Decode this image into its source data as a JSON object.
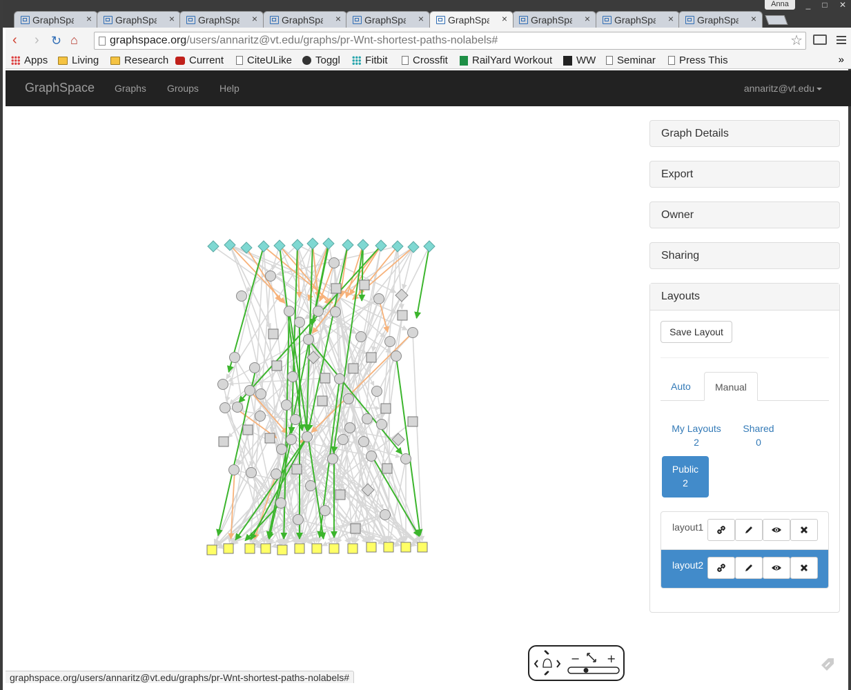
{
  "browser": {
    "tabs": [
      {
        "label": "GraphSpa",
        "active": false
      },
      {
        "label": "GraphSpa",
        "active": false
      },
      {
        "label": "GraphSpa",
        "active": false
      },
      {
        "label": "GraphSpa",
        "active": false
      },
      {
        "label": "GraphSpa",
        "active": false
      },
      {
        "label": "GraphSpa",
        "active": true
      },
      {
        "label": "GraphSpa",
        "active": false
      },
      {
        "label": "GraphSpa",
        "active": false
      },
      {
        "label": "GraphSpa",
        "active": false
      }
    ],
    "profile_name": "Anna",
    "url_host": "graphspace.org",
    "url_path": "/users/annaritz@vt.edu/graphs/pr-Wnt-shortest-paths-nolabels#",
    "bookmarks": [
      "Apps",
      "Living",
      "Research",
      "Current",
      "CiteULike",
      "Toggl",
      "Fitbit",
      "Crossfit",
      "RailYard Workout",
      "WW",
      "Seminar",
      "Press This"
    ],
    "bookmarks_more": "»",
    "status_text": "graphspace.org/users/annaritz@vt.edu/graphs/pr-Wnt-shortest-paths-nolabels#"
  },
  "navbar": {
    "brand": "GraphSpace",
    "links": [
      "Graphs",
      "Groups",
      "Help"
    ],
    "user": "annaritz@vt.edu"
  },
  "sidebar": {
    "panels": [
      "Graph Details",
      "Export",
      "Owner",
      "Sharing"
    ],
    "layouts": {
      "title": "Layouts",
      "save_label": "Save Layout",
      "tabs": [
        "Auto",
        "Manual"
      ],
      "active_tab": "Manual",
      "filters": [
        {
          "label": "My Layouts",
          "count": "2"
        },
        {
          "label": "Shared",
          "count": "0"
        },
        {
          "label": "Public",
          "count": "2"
        }
      ],
      "items": [
        {
          "name": "layout1",
          "selected": false
        },
        {
          "name": "layout2",
          "selected": true
        }
      ]
    }
  },
  "colors": {
    "navbar_bg": "#222222",
    "accent": "#428bca",
    "source_node": "#7fd8d2",
    "target_node": "#ffff66",
    "green_edge": "#3cb52d",
    "orange_edge": "#f7b27a",
    "grey_edge": "#d8d8d8",
    "grey_node": "#d6d6d6"
  }
}
